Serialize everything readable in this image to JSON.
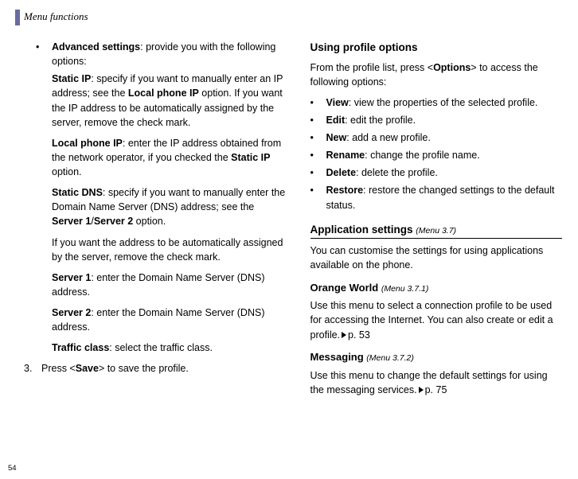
{
  "header": {
    "title": "Menu functions"
  },
  "left": {
    "adv": {
      "label": "Advanced settings",
      "text": ": provide you with the following options:"
    },
    "staticip": {
      "label": "Static IP",
      "t1": ": specify if you want to manually enter an IP address; see the ",
      "local": "Local phone IP",
      "t2": " option. If you want the IP address to be automatically assigned by the server, remove the check mark."
    },
    "localip": {
      "label": "Local phone IP",
      "t1": ": enter the IP address obtained from the network operator, if you checked the ",
      "static": "Static IP",
      "t2": " option."
    },
    "staticdns": {
      "label": "Static DNS",
      "t1": ": specify if you want to manually enter the Domain Name Server (DNS) address; see the ",
      "srv": "Server 1",
      "slash": "/",
      "srv2": "Server 2",
      "t2": " option."
    },
    "dnsauto": "If you want the address to be automatically assigned by the server, remove the check mark.",
    "server1": {
      "label": "Server 1",
      "text": ": enter the Domain Name Server (DNS) address."
    },
    "server2": {
      "label": "Server 2",
      "text": ": enter the Domain Name Server (DNS) address."
    },
    "traffic": {
      "label": "Traffic class",
      "text": ": select the traffic class."
    },
    "step3": {
      "num": "3.",
      "t1": "Press <",
      "save": "Save",
      "t2": "> to save the profile."
    }
  },
  "right": {
    "useprofile": {
      "title": "Using profile options",
      "t1": "From the profile list, press <",
      "opt": "Options",
      "t2": "> to access the following options:"
    },
    "opts": {
      "view": {
        "label": "View",
        "text": ": view the properties of the selected profile."
      },
      "edit": {
        "label": "Edit",
        "text": ": edit the profile."
      },
      "new": {
        "label": "New",
        "text": ": add a new profile."
      },
      "rename": {
        "label": "Rename",
        "text": ": change the profile name."
      },
      "delete": {
        "label": "Delete",
        "text": ": delete the profile."
      },
      "restore": {
        "label": "Restore",
        "text": ": restore the changed settings to the default status."
      }
    },
    "appsettings": {
      "title": "Application settings ",
      "ref": "(Menu 3.7)",
      "text": "You can customise the settings for using applications available on the phone."
    },
    "orange": {
      "title": "Orange World ",
      "ref": "(Menu 3.7.1)",
      "t1": "Use this menu to select a connection profile to be used for accessing the Internet. You can also create or edit a profile.",
      "pref": "p. 53"
    },
    "messaging": {
      "title": "Messaging ",
      "ref": "(Menu 3.7.2)",
      "t1": "Use this menu to change the default settings for using the messaging services.",
      "pref": "p. 75"
    }
  },
  "pagenum": "54"
}
